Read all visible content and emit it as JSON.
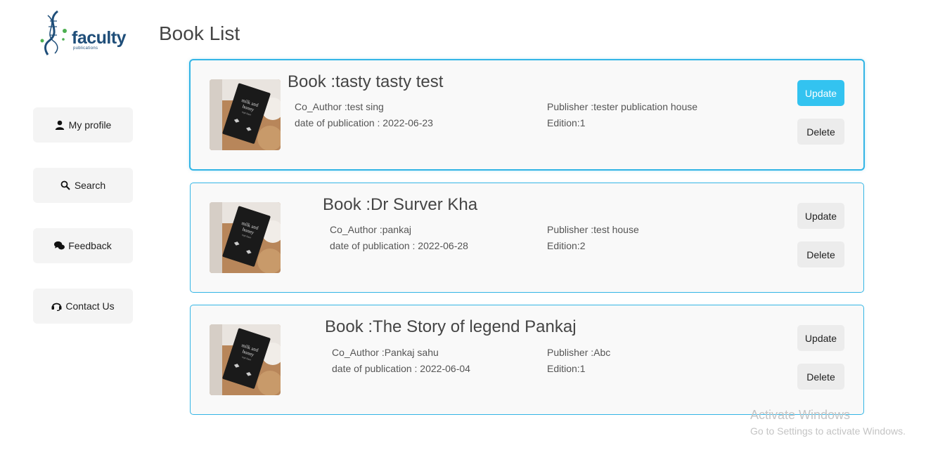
{
  "logo": {
    "word": "faculty",
    "sub": "publications"
  },
  "page": {
    "title": "Book List"
  },
  "sidebar": {
    "items": [
      {
        "label": "My profile",
        "icon": "user-icon"
      },
      {
        "label": "Search",
        "icon": "search-icon"
      },
      {
        "label": "Feedback",
        "icon": "chat-icon"
      },
      {
        "label": "Contact Us",
        "icon": "headset-icon"
      }
    ]
  },
  "books": [
    {
      "title": "Book :tasty tasty test",
      "co_author": "Co_Author :test sing",
      "date": "date of publication : 2022-06-23",
      "publisher": "Publisher :tester publication house",
      "edition": "Edition:1",
      "update_label": "Update",
      "delete_label": "Delete"
    },
    {
      "title": "Book :Dr Surver Kha",
      "co_author": "Co_Author :pankaj",
      "date": "date of publication : 2022-06-28",
      "publisher": "Publisher :test house",
      "edition": "Edition:2",
      "update_label": "Update",
      "delete_label": "Delete"
    },
    {
      "title": "Book :The Story of legend Pankaj",
      "co_author": "Co_Author :Pankaj sahu",
      "date": "date of publication : 2022-06-04",
      "publisher": "Publisher :Abc",
      "edition": "Edition:1",
      "update_label": "Update",
      "delete_label": "Delete"
    }
  ],
  "watermark": {
    "line1": "Activate Windows",
    "line2": "Go to Settings to activate Windows."
  },
  "colors": {
    "accent": "#33c3f0",
    "border": "#33b5e5",
    "brand": "#1f4e79"
  }
}
